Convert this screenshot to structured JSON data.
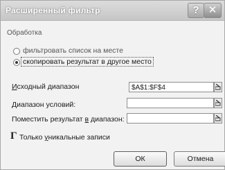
{
  "dialog": {
    "title": "Расширенный фильтр",
    "help_label": "?",
    "close_label": "✕"
  },
  "processing": {
    "group_label": "Обработка",
    "options": [
      {
        "label": "фильтровать список на месте",
        "checked": false
      },
      {
        "label": "скопировать результат в другое место",
        "checked": true
      }
    ]
  },
  "fields": {
    "source_range": {
      "label_accel": "И",
      "label_rest": "сходный диапазон",
      "value": "$A$1:$F$4"
    },
    "criteria_range": {
      "label": "Диапазон условий:",
      "value": ""
    },
    "copy_to": {
      "label_pre": "Поместить результат ",
      "label_accel": "в",
      "label_post": " диапазон:",
      "value": ""
    }
  },
  "unique_only": {
    "mark": "Г",
    "label_pre": "Только ",
    "label_accel": "у",
    "label_post": "никальные записи"
  },
  "buttons": {
    "ok": "ОК",
    "cancel": "Отмена"
  }
}
